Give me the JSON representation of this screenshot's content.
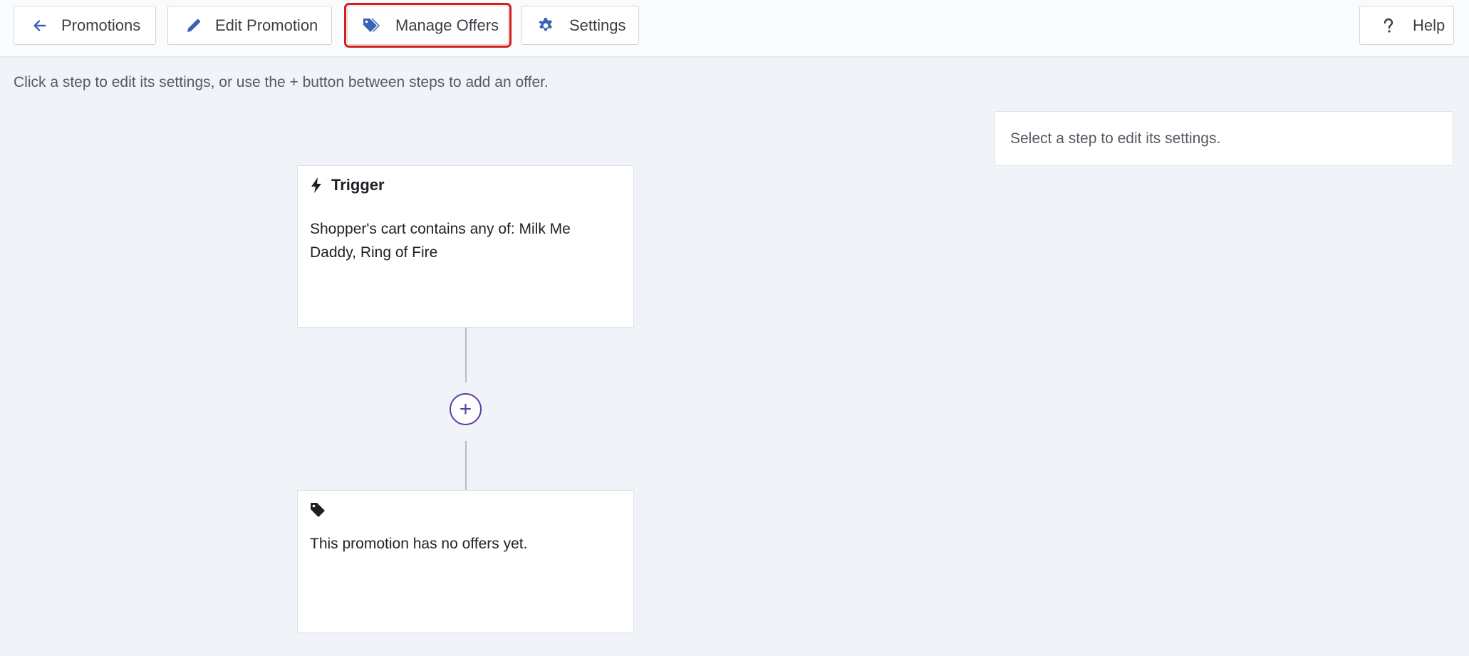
{
  "toolbar": {
    "promotions_label": "Promotions",
    "edit_promotion_label": "Edit Promotion",
    "manage_offers_label": "Manage Offers",
    "settings_label": "Settings",
    "help_label": "Help"
  },
  "instruction": "Click a step to edit its settings, or use the + button between steps to add an offer.",
  "side_panel": {
    "message": "Select a step to edit its settings."
  },
  "trigger_card": {
    "title": "Trigger",
    "description": "Shopper's cart contains any of: Milk Me Daddy, Ring of Fire"
  },
  "add_step": {
    "symbol": "+"
  },
  "offers_card": {
    "message": "This promotion has no offers yet."
  },
  "colors": {
    "accent_icon": "#3a63b5",
    "add_button": "#5b3fa8",
    "highlight_outline": "#d81c1c",
    "background": "#f0f3f7"
  },
  "icons": {
    "promotions": "arrow-left-icon",
    "edit_promotion": "pencil-icon",
    "manage_offers": "tags-icon",
    "settings": "gear-icon",
    "help": "question-icon",
    "trigger": "bolt-icon",
    "offers": "tag-icon"
  }
}
